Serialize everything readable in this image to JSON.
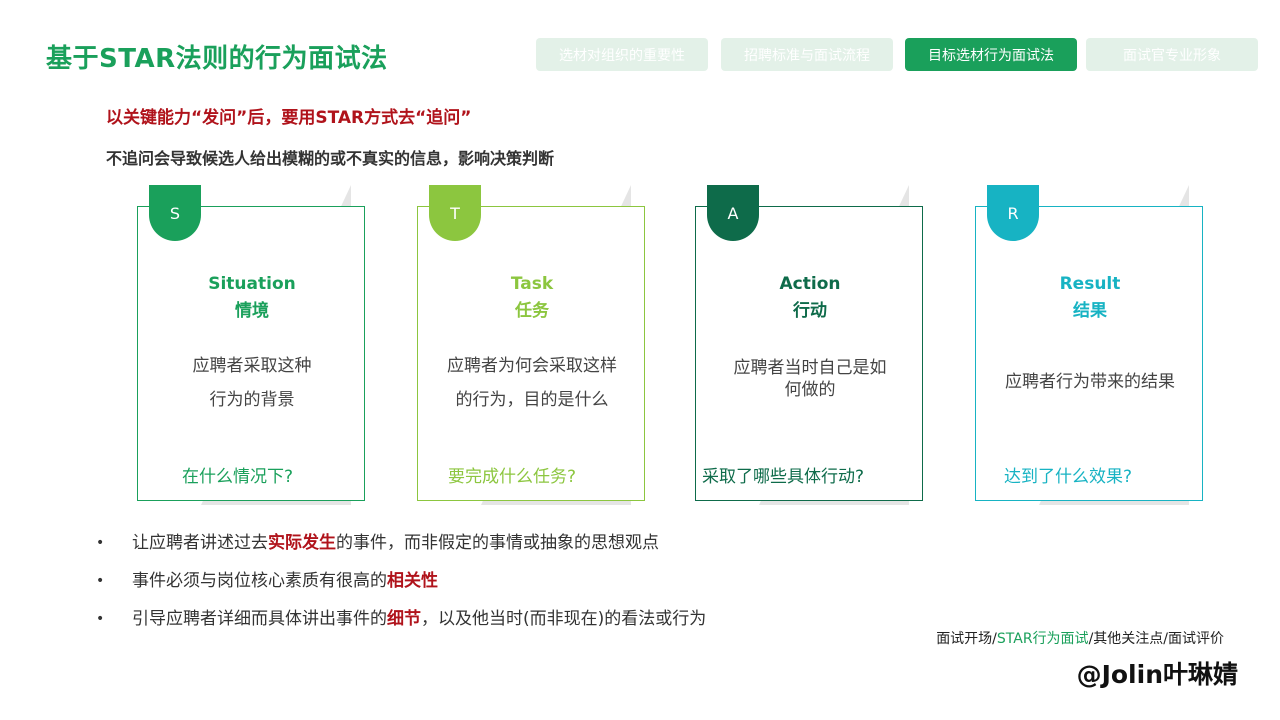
{
  "title": "基于STAR法则的行为面试法",
  "tabs": [
    {
      "label": "选材对组织的重要性",
      "active": false
    },
    {
      "label": "招聘标准与面试流程",
      "active": false
    },
    {
      "label": "目标选材行为面试法",
      "active": true
    },
    {
      "label": "面试官专业形象",
      "active": false
    }
  ],
  "subtitle1": "以关键能力“发问”后，要用STAR方式去“追问”",
  "subtitle2": "不追问会导致候选人给出模糊的或不真实的信息，影响决策判断",
  "colors": {
    "primary": "#1aa05b",
    "highlight": "#b0131b"
  },
  "cards": [
    {
      "letter": "S",
      "title_en": "Situation",
      "title_cn": "情境",
      "desc1": "应聘者采取这种",
      "desc2": "行为的背景",
      "question": "在什么情况下?",
      "color": "#1aa05b"
    },
    {
      "letter": "T",
      "title_en": "Task",
      "title_cn": "任务",
      "desc1": "应聘者为何会采取这样",
      "desc2": "的行为，目的是什么",
      "question": "要完成什么任务?",
      "color": "#8cc63f"
    },
    {
      "letter": "A",
      "title_en": "Action",
      "title_cn": "行动",
      "desc1": "应聘者当时自己是如",
      "desc2": "何做的",
      "question": "采取了哪些具体行动?",
      "color": "#0e6b4a"
    },
    {
      "letter": "R",
      "title_en": "Result",
      "title_cn": "结果",
      "desc1": "应聘者行为带来的结果",
      "desc2": "",
      "question": "达到了什么效果?",
      "color": "#17b3c3"
    }
  ],
  "bullets": [
    {
      "pre": "让应聘者讲述过去",
      "hl": "实际发生",
      "post": "的事件，而非假定的事情或抽象的思想观点"
    },
    {
      "pre": "事件必须与岗位核心素质有很高的",
      "hl": "相关性",
      "post": ""
    },
    {
      "pre": "引导应聘者详细而具体讲出事件的",
      "hl": "细节",
      "post": "，以及他当时(而非现在)的看法或行为"
    }
  ],
  "footer_nav": {
    "p1": "面试开场/",
    "current": "STAR行为面试",
    "p2": "/其他关注点/面试评价"
  },
  "watermark": "@Jolin叶琳婧"
}
